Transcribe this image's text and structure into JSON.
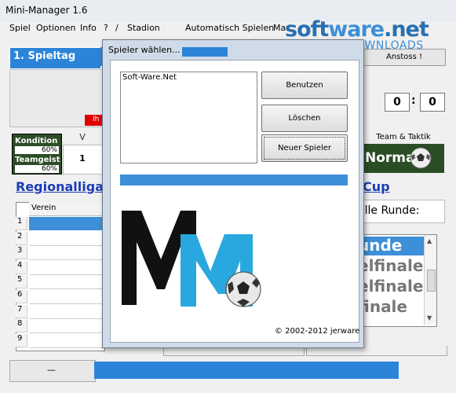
{
  "window": {
    "title": "Mini-Manager 1.6"
  },
  "menu": [
    "Spiel",
    "Optionen",
    "Info",
    "?",
    "/",
    "Stadion",
    "Automatisch Spielen",
    "Ma"
  ],
  "watermark": {
    "brand_a": "soft",
    "brand_b": "ware",
    "brand_c": ".net",
    "tagline": "AKTUELLE DOWNLOADS"
  },
  "background": {
    "spieltag": "1. Spieltag",
    "red_label": "Ih",
    "kondition_label": "Kondition",
    "kondition_value": "60%",
    "teamgeist_label": "Teamgeist",
    "teamgeist_value": "60%",
    "v_header": "V",
    "v_value": "1",
    "league_link": "Regionalliga",
    "table_header": "Verein",
    "row_numbers": [
      "1",
      "2",
      "3",
      "4",
      "5",
      "6",
      "7",
      "8",
      "9"
    ],
    "anstoss_button": "Anstoss !",
    "score_home": "0",
    "score_sep": ":",
    "score_away": "0",
    "team_taktik_header": "Team & Taktik",
    "tactic_value": "Normal",
    "cup_link": "Cup",
    "current_round": "elle Runde:",
    "rounds": [
      "unde",
      "elfinale",
      "elfinale",
      "finale"
    ],
    "bottom_dash": "—"
  },
  "dialog": {
    "title": "Spieler wählen...",
    "players": [
      "Soft-Ware.Net"
    ],
    "buttons": {
      "use": "Benutzen",
      "delete": "Löschen",
      "new": "Neuer Spieler"
    },
    "copyright": "© 2002-2012 jerware"
  },
  "colors": {
    "accent": "#2c84d9",
    "dark_green": "#2b4d25",
    "link_blue": "#1a3cb5",
    "logo_blue": "#29a8e0"
  }
}
